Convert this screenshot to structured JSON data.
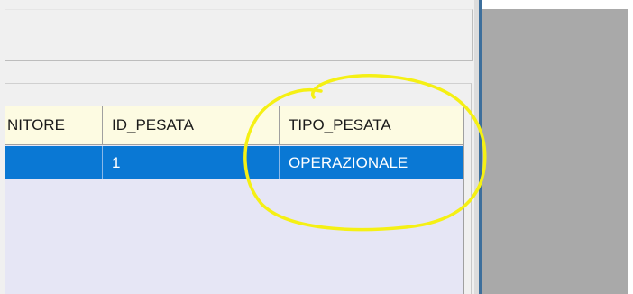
{
  "grid": {
    "columns": [
      {
        "label": "NITORE"
      },
      {
        "label": "ID_PESATA"
      },
      {
        "label": "TIPO_PESATA"
      }
    ],
    "rows": [
      {
        "cells": [
          "",
          "1",
          "OPERAZIONALE"
        ]
      }
    ],
    "selection_color": "#0a78d4",
    "header_color": "#fdfbe2",
    "background_color": "#e6e6f5"
  },
  "annotation": {
    "color": "#f5f014",
    "shape": "hand-drawn-ellipse"
  }
}
